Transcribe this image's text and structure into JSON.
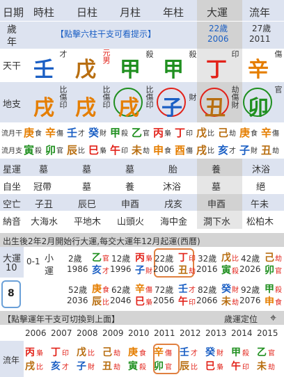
{
  "header": {
    "col_date": "日期",
    "col_hour": "時柱",
    "col_day": "日柱",
    "col_month": "月柱",
    "col_year": "年柱",
    "col_dayun": "大運",
    "col_liunian": "流年",
    "age_label_1": "歲",
    "age_label_2": "年",
    "hint": "【點擊六柱干支可看提示】",
    "dayun_age": "22歲",
    "dayun_year": "2006",
    "liunian_age": "27歲",
    "liunian_year": "2011"
  },
  "tiangan": {
    "label": "天干",
    "hour": {
      "char": "壬",
      "tag": "才"
    },
    "day": {
      "char": "戊",
      "tag": "元男"
    },
    "month": {
      "char": "甲",
      "tag": "殺"
    },
    "year": {
      "char": "甲",
      "tag": "殺"
    },
    "dayun": {
      "char": "丁",
      "tag": "印"
    },
    "liunian": {
      "char": "辛",
      "tag": "傷"
    }
  },
  "dizhi": {
    "label": "地支",
    "hour": {
      "char": "戌",
      "tag": "比傷印"
    },
    "day": {
      "char": "戌",
      "tag": "比傷印"
    },
    "month": {
      "char": "戌",
      "tag": "比傷印"
    },
    "year": {
      "char": "子",
      "tag": "財"
    },
    "dayun": {
      "char": "丑",
      "tag": "劫傷財"
    },
    "liunian": {
      "char": "卯",
      "tag": "官"
    }
  },
  "liuyue": {
    "label1": "流月干",
    "label2": "流月支",
    "gan": [
      {
        "c": "庚",
        "t": "食"
      },
      {
        "c": "辛",
        "t": "傷"
      },
      {
        "c": "壬",
        "t": "才"
      },
      {
        "c": "癸",
        "t": "財"
      },
      {
        "c": "甲",
        "t": "殺"
      },
      {
        "c": "乙",
        "t": "官"
      },
      {
        "c": "丙",
        "t": "梟"
      },
      {
        "c": "丁",
        "t": "印"
      },
      {
        "c": "戊",
        "t": "比"
      },
      {
        "c": "己",
        "t": "劫"
      },
      {
        "c": "庚",
        "t": "食"
      },
      {
        "c": "辛",
        "t": "傷"
      }
    ],
    "zhi": [
      {
        "c": "寅",
        "t": "殺"
      },
      {
        "c": "卯",
        "t": "官"
      },
      {
        "c": "辰",
        "t": "比"
      },
      {
        "c": "巳",
        "t": "梟"
      },
      {
        "c": "午",
        "t": "印"
      },
      {
        "c": "未",
        "t": "劫"
      },
      {
        "c": "申",
        "t": "食"
      },
      {
        "c": "酉",
        "t": "傷"
      },
      {
        "c": "戌",
        "t": "比"
      },
      {
        "c": "亥",
        "t": "才"
      },
      {
        "c": "子",
        "t": "財"
      },
      {
        "c": "丑",
        "t": "劫"
      }
    ]
  },
  "table": {
    "xingyun": {
      "label": "星運",
      "hour": "墓",
      "day": "墓",
      "month": "墓",
      "year": "胎",
      "dayun": "養",
      "liunian": "沐浴"
    },
    "zizuo": {
      "label": "自坐",
      "hour": "冠帶",
      "day": "墓",
      "month": "養",
      "year": "沐浴",
      "dayun": "墓",
      "liunian": "絕"
    },
    "kongwang": {
      "label": "空亡",
      "hour": "子丑",
      "day": "辰巳",
      "month": "申酉",
      "year": "戌亥",
      "dayun": "申酉",
      "liunian": "午未"
    },
    "nayin": {
      "label": "納音",
      "hour": "大海水",
      "day": "平地木",
      "month": "山頭火",
      "year": "海中金",
      "dayun": "澗下水",
      "liunian": "松柏木"
    }
  },
  "qiyun": "出生後2年2月開始行大運,每交大運年12月起運(西曆)",
  "dayun_panel": {
    "label": "大運",
    "start_age": "10",
    "range": "0-1",
    "xiao": "小",
    "yun": "運",
    "current": "8",
    "items": [
      {
        "age": "2歲",
        "year": "1986",
        "g": "乙",
        "z": "亥",
        "gt": "官",
        "zt": "才"
      },
      {
        "age": "12歲",
        "year": "1996",
        "g": "丙",
        "z": "子",
        "gt": "梟",
        "zt": "財"
      },
      {
        "age": "22歲",
        "year": "2006",
        "g": "丁",
        "z": "丑",
        "gt": "印",
        "zt": "劫"
      },
      {
        "age": "32歲",
        "year": "2016",
        "g": "戊",
        "z": "寅",
        "gt": "比",
        "zt": "殺"
      },
      {
        "age": "42歲",
        "year": "2026",
        "g": "己",
        "z": "卯",
        "gt": "劫",
        "zt": "官"
      },
      {
        "age": "52歲",
        "year": "2036",
        "g": "庚",
        "z": "辰",
        "gt": "食",
        "zt": "比"
      },
      {
        "age": "62歲",
        "year": "2046",
        "g": "辛",
        "z": "巳",
        "gt": "傷",
        "zt": "梟"
      },
      {
        "age": "72歲",
        "year": "2056",
        "g": "壬",
        "z": "午",
        "gt": "才",
        "zt": "印"
      },
      {
        "age": "82歲",
        "year": "2066",
        "g": "癸",
        "z": "未",
        "gt": "財",
        "zt": "劫"
      },
      {
        "age": "92歲",
        "year": "2076",
        "g": "甲",
        "z": "申",
        "gt": "殺",
        "zt": "食"
      }
    ]
  },
  "switch_hint": "【點擊運年干支可切換到上面】",
  "locate": "歲運定位",
  "liunian_panel": {
    "label": "流年",
    "years": [
      "2006",
      "2007",
      "2008",
      "2009",
      "2010",
      "2011",
      "2012",
      "2013",
      "2014",
      "2015"
    ],
    "items": [
      {
        "g": "丙",
        "z": "戌",
        "gt": "梟",
        "zt": "比"
      },
      {
        "g": "丁",
        "z": "亥",
        "gt": "印",
        "zt": "才"
      },
      {
        "g": "戊",
        "z": "子",
        "gt": "比",
        "zt": "財"
      },
      {
        "g": "己",
        "z": "丑",
        "gt": "劫",
        "zt": "劫"
      },
      {
        "g": "庚",
        "z": "寅",
        "gt": "食",
        "zt": "殺"
      },
      {
        "g": "辛",
        "z": "卯",
        "gt": "傷",
        "zt": "官"
      },
      {
        "g": "壬",
        "z": "辰",
        "gt": "才",
        "zt": "比"
      },
      {
        "g": "癸",
        "z": "巳",
        "gt": "財",
        "zt": "梟"
      },
      {
        "g": "甲",
        "z": "午",
        "gt": "殺",
        "zt": "印"
      },
      {
        "g": "乙",
        "z": "未",
        "gt": "官",
        "zt": "劫"
      }
    ]
  },
  "colors": {
    "blue": "#1b5fc4",
    "brown": "#b86e10",
    "green": "#1f8f1f",
    "red": "#e2231a",
    "box": "#e08040"
  }
}
